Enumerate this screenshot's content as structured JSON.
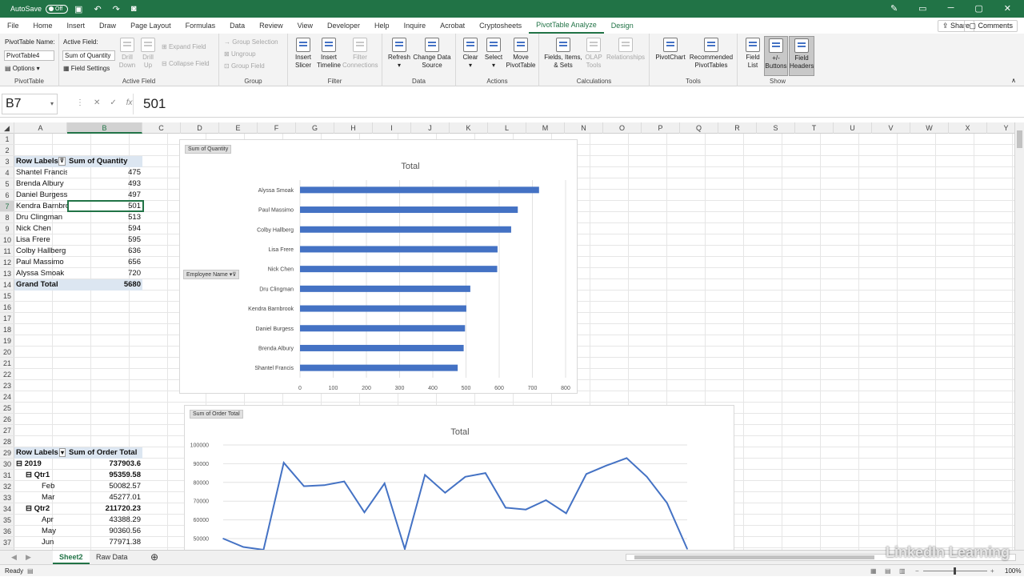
{
  "titlebar": {
    "autosave_label": "AutoSave",
    "autosave_state": "Off"
  },
  "tabs": [
    "File",
    "Home",
    "Insert",
    "Draw",
    "Page Layout",
    "Formulas",
    "Data",
    "Review",
    "View",
    "Developer",
    "Help",
    "Inquire",
    "Acrobat",
    "Cryptosheets",
    "PivotTable Analyze",
    "Design"
  ],
  "active_tab": "PivotTable Analyze",
  "share_label": "Share",
  "comments_label": "Comments",
  "ribbon": {
    "pivottable": {
      "name_label": "PivotTable Name:",
      "name_value": "PivotTable4",
      "options": "Options",
      "group": "PivotTable"
    },
    "active_field": {
      "label": "Active Field:",
      "value": "Sum of Quantity",
      "settings": "Field Settings",
      "drill_down": "Drill Down",
      "drill_up": "Drill Up",
      "expand": "Expand Field",
      "collapse": "Collapse Field",
      "group": "Active Field"
    },
    "group_grp": {
      "selection": "Group Selection",
      "ungroup": "Ungroup",
      "field": "Group Field",
      "group": "Group"
    },
    "filter": {
      "slicer": "Insert Slicer",
      "timeline": "Insert Timeline",
      "connections": "Filter Connections",
      "group": "Filter"
    },
    "data": {
      "refresh": "Refresh",
      "change": "Change Data Source",
      "group": "Data"
    },
    "actions": {
      "clear": "Clear",
      "select": "Select",
      "move": "Move PivotTable",
      "group": "Actions"
    },
    "calculations": {
      "fields": "Fields, Items, & Sets",
      "olap": "OLAP Tools",
      "relationships": "Relationships",
      "group": "Calculations"
    },
    "tools": {
      "pivotchart": "PivotChart",
      "recommended": "Recommended PivotTables",
      "group": "Tools"
    },
    "show": {
      "field_list": "Field List",
      "buttons": "+/- Buttons",
      "headers": "Field Headers",
      "group": "Show"
    }
  },
  "formula_bar": {
    "name_box": "B7",
    "value": "501"
  },
  "columns": [
    "A",
    "B",
    "C",
    "D",
    "E",
    "F",
    "G",
    "H",
    "I",
    "J",
    "K",
    "L",
    "M",
    "N",
    "O",
    "P",
    "Q",
    "R",
    "S",
    "T",
    "U",
    "V",
    "W",
    "X",
    "Y"
  ],
  "rows": [
    "1",
    "2",
    "3",
    "4",
    "5",
    "6",
    "7",
    "8",
    "9",
    "10",
    "11",
    "12",
    "13",
    "14",
    "15",
    "16",
    "17",
    "18",
    "19",
    "20",
    "21",
    "22",
    "23",
    "24",
    "25",
    "26",
    "27",
    "28",
    "29",
    "30",
    "31",
    "32",
    "33",
    "34",
    "35",
    "36",
    "37"
  ],
  "pivot1": {
    "header": [
      "Row Labels",
      "Sum of Quantity"
    ],
    "rows": [
      [
        "Shantel Francis",
        "475"
      ],
      [
        "Brenda Albury",
        "493"
      ],
      [
        "Daniel Burgess",
        "497"
      ],
      [
        "Kendra Barnbrook",
        "501"
      ],
      [
        "Dru Clingman",
        "513"
      ],
      [
        "Nick Chen",
        "594"
      ],
      [
        "Lisa Frere",
        "595"
      ],
      [
        "Colby Hallberg",
        "636"
      ],
      [
        "Paul Massimo",
        "656"
      ],
      [
        "Alyssa Smoak",
        "720"
      ]
    ],
    "total": [
      "Grand Total",
      "5680"
    ]
  },
  "pivot2": {
    "header": [
      "Row Labels",
      "Sum of Order Total"
    ],
    "rows": [
      {
        "label": "2019",
        "value": "737903.6",
        "level": 0
      },
      {
        "label": "Qtr1",
        "value": "95359.58",
        "level": 1
      },
      {
        "label": "Feb",
        "value": "50082.57",
        "level": 2
      },
      {
        "label": "Mar",
        "value": "45277.01",
        "level": 2
      },
      {
        "label": "Qtr2",
        "value": "211720.23",
        "level": 1
      },
      {
        "label": "Apr",
        "value": "43388.29",
        "level": 2
      },
      {
        "label": "May",
        "value": "90360.56",
        "level": 2
      },
      {
        "label": "Jun",
        "value": "77971.38",
        "level": 2
      }
    ]
  },
  "chart1_fields": {
    "value_button": "Sum of Quantity",
    "axis_button": "Employee Name"
  },
  "chart2_fields": {
    "value_button": "Sum of Order Total"
  },
  "chart_data": [
    {
      "type": "bar",
      "title": "Total",
      "categories": [
        "Alyssa Smoak",
        "Paul Massimo",
        "Colby Hallberg",
        "Lisa Frere",
        "Nick Chen",
        "Dru Clingman",
        "Kendra Barnbrook",
        "Daniel Burgess",
        "Brenda Albury",
        "Shantel Francis"
      ],
      "values": [
        720,
        656,
        636,
        595,
        594,
        513,
        501,
        497,
        493,
        475
      ],
      "xlim": [
        0,
        800
      ],
      "xticks": [
        "0",
        "100",
        "200",
        "300",
        "400",
        "500",
        "600",
        "700",
        "800"
      ],
      "color": "#4472c4",
      "grid": true
    },
    {
      "type": "line",
      "title": "Total",
      "values": [
        50000,
        45500,
        44000,
        90500,
        78000,
        78500,
        80500,
        64000,
        79500,
        44500,
        84000,
        74500,
        83000,
        85000,
        66500,
        65500,
        70500,
        63500,
        84500,
        89000,
        93000,
        83000,
        69000,
        44500
      ],
      "ylim": [
        40000,
        100000
      ],
      "yticks": [
        "100000",
        "90000",
        "80000",
        "70000",
        "60000",
        "50000"
      ],
      "color": "#4472c4",
      "grid": true
    }
  ],
  "sheets": [
    "Sheet2",
    "Raw Data"
  ],
  "active_sheet": "Sheet2",
  "status": {
    "ready": "Ready",
    "zoom": "100%"
  },
  "watermark": "LinkedIn Learning"
}
